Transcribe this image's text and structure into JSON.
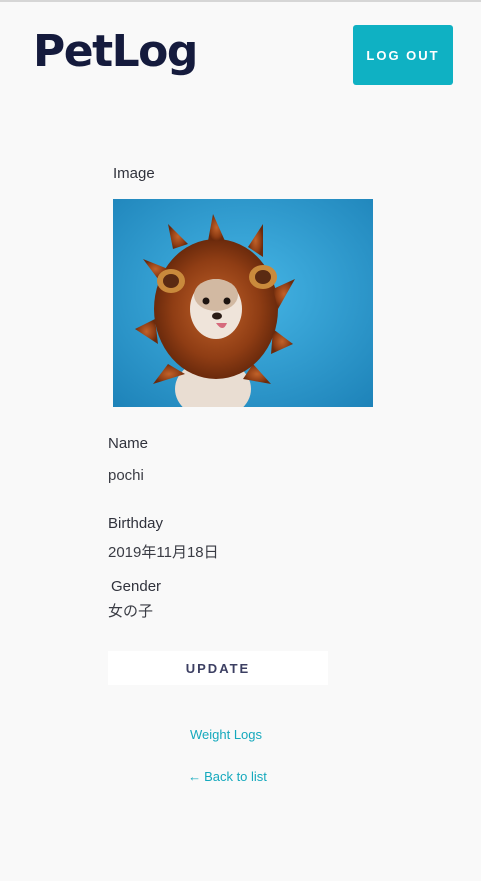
{
  "header": {
    "brand": "PetLog",
    "logout_label": "LOG OUT"
  },
  "pet": {
    "image_label": "Image",
    "image_alt": "lion-mane dog photo",
    "name_label": "Name",
    "name_value": "pochi",
    "birthday_label": "Birthday",
    "birthday_value": "2019年11月18日",
    "gender_label": "Gender",
    "gender_value": "女の子"
  },
  "actions": {
    "update_label": "UPDATE",
    "weight_logs_label": "Weight Logs",
    "back_arrow": "←",
    "back_label": "Back to list"
  },
  "colors": {
    "accent": "#0fb1c3",
    "brand_text": "#151b3d",
    "background": "#f9f9f9"
  }
}
